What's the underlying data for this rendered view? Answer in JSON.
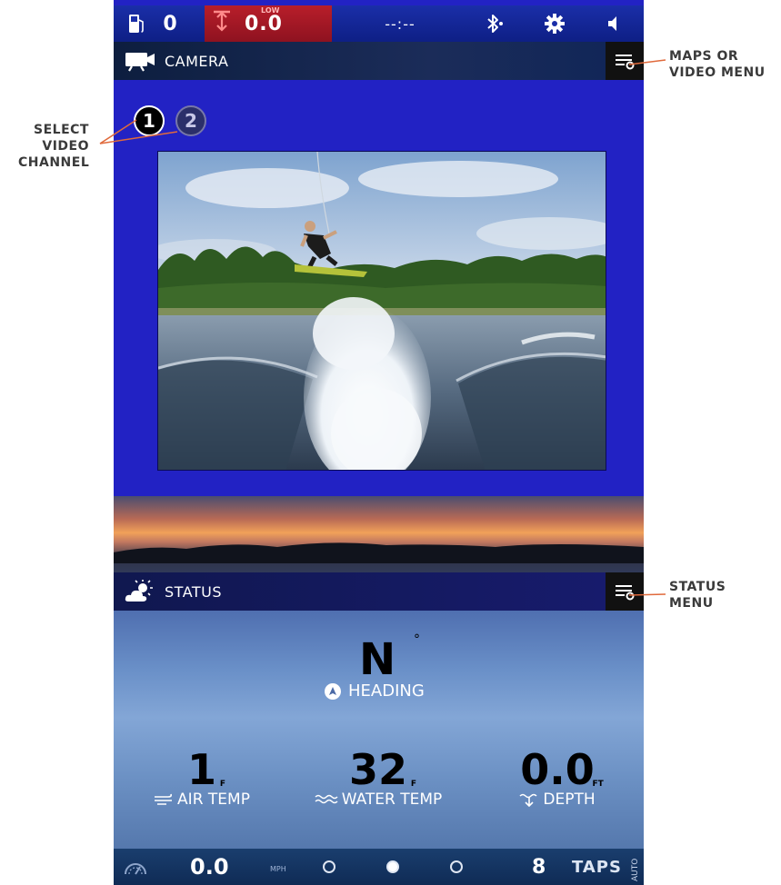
{
  "callouts": {
    "video_channel": [
      "SELECT",
      "VIDEO",
      "CHANNEL"
    ],
    "maps_menu": [
      "MAPS OR",
      "VIDEO MENU"
    ],
    "status_menu": [
      "STATUS",
      "MENU"
    ]
  },
  "topbar": {
    "fuel_icon": "fuel-pump-icon",
    "fuel_value": "0",
    "depth_alarm_label": "LOW",
    "depth_value": "0.0",
    "clock": "--:--",
    "bluetooth_icon": "bluetooth-icon",
    "settings_icon": "gear-icon",
    "volume_icon": "speaker-icon",
    "alarm_color": "#b81e2a"
  },
  "camera_panel": {
    "title": "CAMERA",
    "icon": "video-camera-icon",
    "channels": [
      {
        "label": "1",
        "selected": true
      },
      {
        "label": "2",
        "selected": false
      }
    ],
    "menu_icon": "menu-settings-icon"
  },
  "status_panel": {
    "title": "STATUS",
    "icon": "partly-sunny-icon",
    "menu_icon": "menu-settings-icon",
    "heading": {
      "value": "N",
      "degree": "°",
      "label": "HEADING"
    },
    "air_temp": {
      "value": "1",
      "unit": "F",
      "label": "AIR TEMP"
    },
    "water_temp": {
      "value": "32",
      "unit": "F",
      "label": "WATER TEMP"
    },
    "depth": {
      "value": "0.0",
      "unit": "FT",
      "label": "DEPTH"
    }
  },
  "bottombar": {
    "speedometer_icon": "speedometer-icon",
    "speed": "0.0",
    "speed_unit": "MPH",
    "taps_count": "8",
    "taps_label": "TAPS",
    "auto_label": "AUTO",
    "dots": [
      false,
      true,
      false
    ]
  },
  "colors": {
    "screen_blue": "#2222c4",
    "topbar": "#1a2ea8",
    "callout_line": "#e06a3c"
  }
}
